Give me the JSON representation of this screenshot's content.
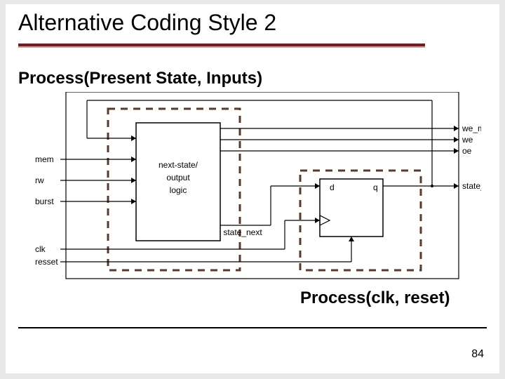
{
  "title": "Alternative Coding Style 2",
  "labels": {
    "process1": "Process(Present State, Inputs)",
    "process2": "Process(clk, reset)"
  },
  "page_number": "84",
  "diagram": {
    "inputs": [
      "mem",
      "rw",
      "burst",
      "clk",
      "resset"
    ],
    "outputs": [
      "we_me",
      "we",
      "oe",
      "state_reg"
    ],
    "blocks": {
      "combo": [
        "next-state/",
        "output",
        "logic"
      ],
      "reg_d": "d",
      "reg_q": "q"
    },
    "internal_signals": [
      "state_next"
    ]
  }
}
